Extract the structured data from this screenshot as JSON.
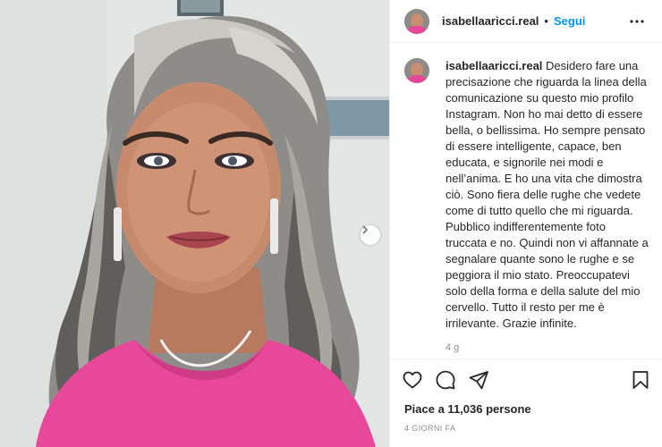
{
  "header": {
    "username": "isabellaaricci.real",
    "separator": "•",
    "follow_label": "Segui",
    "more_icon": "more-horizontal-icon"
  },
  "caption": {
    "username": "isabellaaricci.real",
    "text": "Desidero fare una precisazione che riguarda la linea della comunicazione su questo mio profilo Instagram. Non ho mai detto di essere bella, o bellissima. Ho sempre pensato di essere intelligente, capace, ben educata, e signorile nei modi e nell’anima. E ho una vita che dimostra ciò. Sono fiera delle rughe che vedete come di tutto quello che mi riguarda. Pubblico indifferentemente foto truccata e no. Quindi non vi affannate a segnalare quante sono le rughe e se peggiora il mio stato. Preoccupatevi solo della forma e della salute del mio cervello. Tutto il resto per me è irrilevante. Grazie infinite.",
    "age": "4 g"
  },
  "actions": {
    "like_icon": "heart-icon",
    "comment_icon": "comment-icon",
    "share_icon": "send-icon",
    "save_icon": "bookmark-icon"
  },
  "likes_text": "Piace a 11,036 persone",
  "date_text": "4 GIORNI FA",
  "colors": {
    "follow_blue": "#0095f6",
    "dress_pink": "#e8489a",
    "text_dark": "#262626",
    "text_muted": "#8e8e8e"
  }
}
